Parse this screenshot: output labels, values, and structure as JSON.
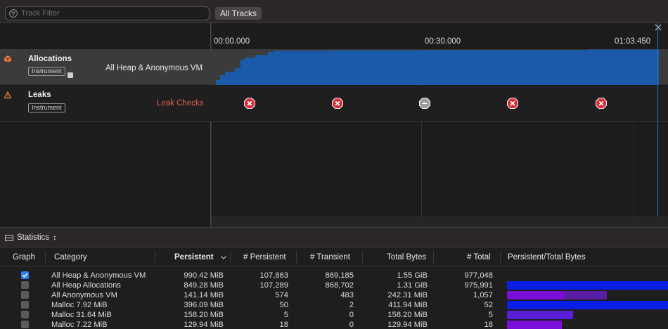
{
  "toolbar": {
    "filter_placeholder": "Track Filter",
    "all_tracks_label": "All Tracks"
  },
  "timeline": {
    "ticks": [
      "00:00.000",
      "00:30.000",
      "01:03.450"
    ]
  },
  "tracks": [
    {
      "title": "Allocations",
      "badge": "Instrument",
      "label": "All Heap & Anonymous VM",
      "label_color": "#e6e6e6",
      "icon_color": "#e8743b"
    },
    {
      "title": "Leaks",
      "badge": "Instrument",
      "label": "Leak Checks",
      "label_color": "#e0634f",
      "icon_color": "#e8743b"
    }
  ],
  "leak_checks": [
    "fail",
    "fail",
    "none",
    "fail",
    "fail"
  ],
  "colors": {
    "alloc_fill": "#1a5aa8",
    "leak_fail": "#d92b36",
    "leak_none": "#9c9c9c",
    "bar_blue": "#0a1ee6",
    "bar_purple": "#7a0fd8",
    "bar_purple_dim": "#5a1ea6",
    "checkbox_on": "#2f7cf6"
  },
  "statistics": {
    "label": "Statistics",
    "chevron": "↕"
  },
  "table": {
    "headers": [
      "Graph",
      "Category",
      "Persistent",
      "# Persistent",
      "# Transient",
      "Total Bytes",
      "# Total",
      "Persistent/Total Bytes"
    ],
    "rows": [
      {
        "checked": true,
        "category": "All Heap & Anonymous VM",
        "persistent": "990.42 MiB",
        "n_persistent": "107,863",
        "n_transient": "869,185",
        "total_bytes": "1.55 GiB",
        "n_total": "977,048",
        "bar_fraction": 0,
        "bar_total": 0,
        "bar_color": "#0a1ee6"
      },
      {
        "checked": false,
        "category": "All Heap Allocations",
        "persistent": "849.28 MiB",
        "n_persistent": "107,289",
        "n_transient": "868,702",
        "total_bytes": "1.31 GiB",
        "n_total": "975,991",
        "bar_fraction": 1.0,
        "bar_total": 1.0,
        "bar_color": "#0a1ee6"
      },
      {
        "checked": false,
        "category": "All Anonymous VM",
        "persistent": "141.14 MiB",
        "n_persistent": "574",
        "n_transient": "483",
        "total_bytes": "242.31 MiB",
        "n_total": "1,057",
        "bar_fraction": 0.36,
        "bar_total": 0.62,
        "bar_color": "#7a0fd8"
      },
      {
        "checked": false,
        "category": "Malloc 7.92 MiB",
        "persistent": "396.09 MiB",
        "n_persistent": "50",
        "n_transient": "2",
        "total_bytes": "411.94 MiB",
        "n_total": "52",
        "bar_fraction": 1.0,
        "bar_total": 1.0,
        "bar_color": "#0a1ee6"
      },
      {
        "checked": false,
        "category": "Malloc 31.64 MiB",
        "persistent": "158.20 MiB",
        "n_persistent": "5",
        "n_transient": "0",
        "total_bytes": "158.20 MiB",
        "n_total": "5",
        "bar_fraction": 0.41,
        "bar_total": 0.41,
        "bar_color": "#5a1ed8"
      },
      {
        "checked": false,
        "category": "Malloc 7.22 MiB",
        "persistent": "129.94 MiB",
        "n_persistent": "18",
        "n_transient": "0",
        "total_bytes": "129.94 MiB",
        "n_total": "18",
        "bar_fraction": 0.34,
        "bar_total": 0.34,
        "bar_color": "#7a0fd8"
      }
    ]
  }
}
